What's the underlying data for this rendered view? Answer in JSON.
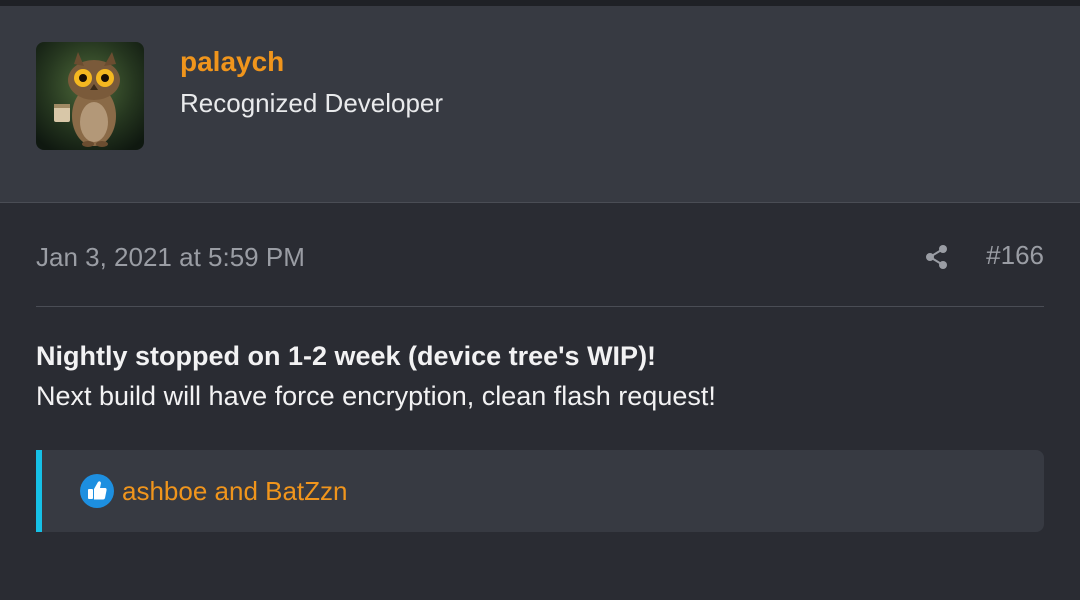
{
  "user": {
    "name": "palaych",
    "title": "Recognized Developer"
  },
  "post": {
    "date": "Jan 3, 2021 at 5:59 PM",
    "number": "#166",
    "line1": "Nightly stopped on 1-2 week (device tree's WIP)!",
    "line2": "Next build will have force encryption, clean flash request!"
  },
  "reactions": {
    "users": "ashboe and BatZzn"
  },
  "colors": {
    "accent_orange": "#f0951c",
    "accent_cyan": "#16c0e6",
    "like_blue": "#1d8fe0"
  }
}
